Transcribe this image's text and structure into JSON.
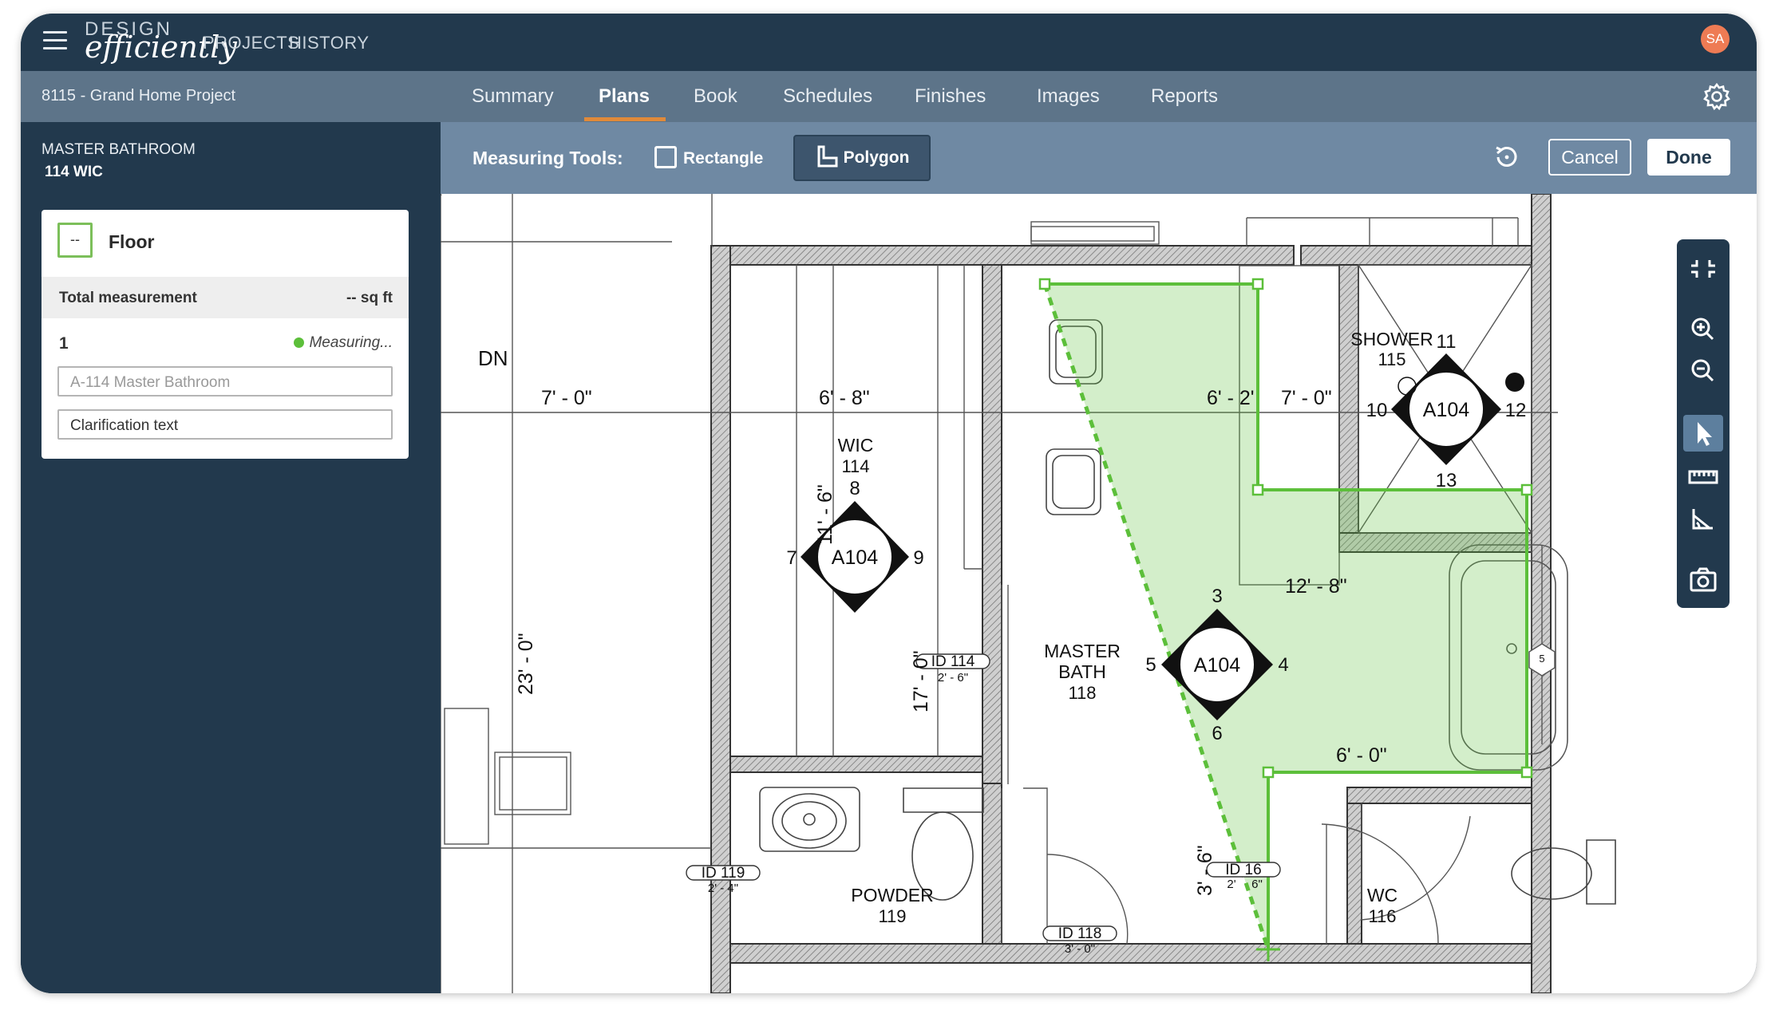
{
  "app": {
    "logo_top": "DESIGN",
    "logo_bottom": "efficiently",
    "nav": [
      "PROJECTS",
      "HISTORY"
    ],
    "avatar_initials": "SA"
  },
  "subheader": {
    "project": "8115 -  Grand Home Project",
    "tabs": [
      "Summary",
      "Plans",
      "Book",
      "Schedules",
      "Finishes",
      "Images",
      "Reports"
    ],
    "active_tab": "Plans"
  },
  "sidebar": {
    "room_caption": "MASTER BATHROOM",
    "room_code": "114 WIC",
    "card": {
      "collapse_label": "--",
      "title": "Floor",
      "total_label": "Total measurement",
      "total_value": "-- sq ft",
      "item_number": "1",
      "status": "Measuring...",
      "name_placeholder": "A-114 Master Bathroom",
      "clarification_value": "Clarification text"
    }
  },
  "toolbar": {
    "label": "Measuring Tools:",
    "rectangle": "Rectangle",
    "polygon": "Polygon",
    "cancel": "Cancel",
    "done": "Done"
  },
  "plan": {
    "labels": {
      "dn": "DN",
      "dim_7_0": "7' - 0\"",
      "dim_6_8": "6' - 8\"",
      "dim_6_2": "6' - 2'",
      "dim_7_0b": "7' - 0\"",
      "dim_12_8": "12' - 8\"",
      "dim_6_0": "6' - 0\"",
      "dim_11_6": "11' - 6\"",
      "dim_17_0": "17' - 0\"",
      "dim_23_0": "23' - 0\"",
      "dim_3_6": "3' - 6\"",
      "wic_name": "WIC",
      "wic_num": "114",
      "shower_name": "SHOWER",
      "shower_num": "115",
      "master_name1": "MASTER",
      "master_name2": "BATH",
      "master_num": "118",
      "powder_name": "POWDER",
      "powder_num": "119",
      "wc_name": "WC",
      "wc_num": "116",
      "a104": "A104",
      "n3": "3",
      "n4": "4",
      "n5": "5",
      "n6": "6",
      "n7": "7",
      "n8": "8",
      "n9": "9",
      "n10": "10",
      "n11": "11",
      "n12": "12",
      "n13": "13",
      "id114": "ID 114",
      "id114_size": "2' - 6\"",
      "id119": "ID 119",
      "id119_size": "2' - 4\"",
      "id118": "ID 118",
      "id118_size": "3' - 0\"",
      "id116": "ID 16",
      "id116_size_a": "2'",
      "id116_size_b": "6\"",
      "hex5": "5"
    }
  },
  "colors": {
    "header": "#22394d",
    "subheader": "#5d7489",
    "toolbar": "#6f89a3",
    "accent": "#e08a3a",
    "measure_green": "#5cbf3a",
    "avatar": "#ee7b54"
  },
  "icons": {
    "right_tools": [
      "collapse-icon",
      "zoom-in-icon",
      "zoom-out-icon",
      "pointer-icon",
      "ruler-icon",
      "angle-icon",
      "camera-icon"
    ]
  }
}
